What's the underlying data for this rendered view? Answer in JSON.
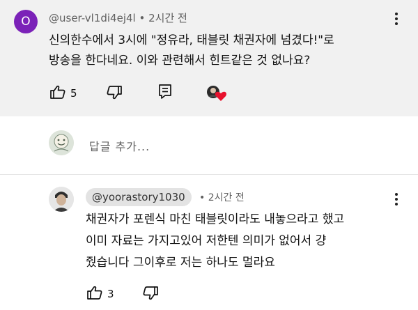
{
  "comment": {
    "avatar_letter": "O",
    "avatar_color": "#7b22b8",
    "author": "@user-vl1di4ej4l",
    "separator": "•",
    "time": "2시간 전",
    "text": "신의한수에서 3시에 \"정유라, 태블릿 채권자에 넘겼다!\"로\n방송을 한다네요. 이와 관련해서 힌트같은 것 없나요?",
    "like_count": "5",
    "creator_heart_color": "#e8112d"
  },
  "reply_box": {
    "placeholder": "답글 추가..."
  },
  "reply": {
    "author": "@yoorastory1030",
    "separator": "•",
    "time": "2시간 전",
    "text": "채권자가 포렌식 마친 태블릿이라도 내놓으라고 했고\n이미 자료는 가지고있어 저한텐 의미가 없어서 걍\n줬습니다 그이후로 저는 하나도 멀라요",
    "like_count": "3"
  },
  "icons": {
    "like": "thumbs-up-icon",
    "dislike": "thumbs-down-icon",
    "reply": "reply-icon",
    "more": "more-vert-icon",
    "heart": "heart-icon"
  }
}
